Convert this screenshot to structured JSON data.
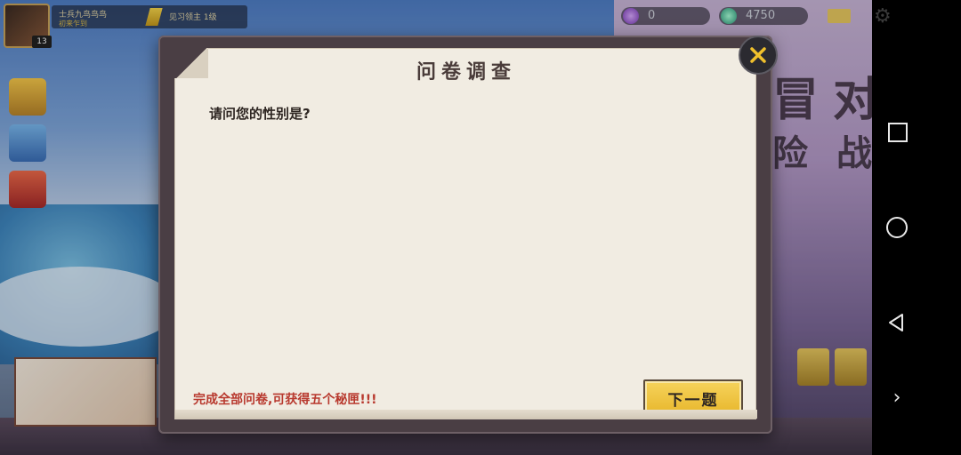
{
  "hud": {
    "player_name": "士兵九鸟鸟鸟",
    "player_sub": "初来乍到",
    "player_title": "见习领主 1级",
    "avatar_level": "13",
    "currency_purple": "0",
    "currency_green": "4750"
  },
  "background": {
    "big_chars": [
      "冒",
      "对",
      "险",
      "战"
    ]
  },
  "dialog": {
    "title": "问卷调查",
    "question": "请问您的性别是?",
    "reward_note": "完成全部问卷,可获得五个秘匣!!!",
    "next_label": "下一题"
  },
  "icons": {
    "close": "close-icon",
    "nav_square": "recents-icon",
    "nav_circle": "home-icon",
    "nav_back": "back-icon",
    "nav_forward": "chevron-right-icon",
    "settings": "gear-icon"
  },
  "colors": {
    "accent_button": "#f6d35c",
    "close_x": "#f0c02c",
    "reward_text": "#b8392e"
  }
}
